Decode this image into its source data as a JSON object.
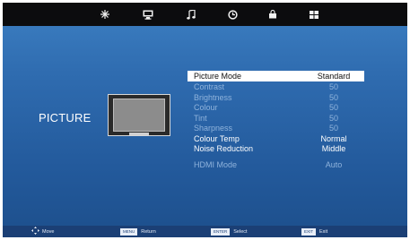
{
  "top_tabs": [
    {
      "icon": "snowflake-icon"
    },
    {
      "icon": "monitor-icon"
    },
    {
      "icon": "music-note-icon"
    },
    {
      "icon": "clock-icon"
    },
    {
      "icon": "lock-icon"
    },
    {
      "icon": "grid-icon"
    }
  ],
  "section_title": "PICTURE",
  "menu": {
    "items": [
      {
        "label": "Picture Mode",
        "value": "Standard",
        "state": "selected"
      },
      {
        "label": "Contrast",
        "value": "50",
        "state": "dim"
      },
      {
        "label": "Brightness",
        "value": "50",
        "state": "dim"
      },
      {
        "label": "Colour",
        "value": "50",
        "state": "dim"
      },
      {
        "label": "Tint",
        "value": "50",
        "state": "dim"
      },
      {
        "label": "Sharpness",
        "value": "50",
        "state": "dim"
      },
      {
        "label": "Colour Temp",
        "value": "Normal",
        "state": "normal"
      },
      {
        "label": "Noise Reduction",
        "value": "Middle",
        "state": "normal"
      },
      {
        "label": "HDMI Mode",
        "value": "Auto",
        "state": "dim"
      }
    ]
  },
  "bottom_bar": {
    "move": "Move",
    "return_key": "MENU",
    "return_label": "Return",
    "select_key": "ENTER",
    "select_label": "Select",
    "exit_key": "EXIT",
    "exit_label": "Exit"
  },
  "colors": {
    "background": "#2f6cb0",
    "topbar": "#0c0c0e",
    "dim_text": "#8fb3dc",
    "selected_bg": "#ffffff"
  }
}
